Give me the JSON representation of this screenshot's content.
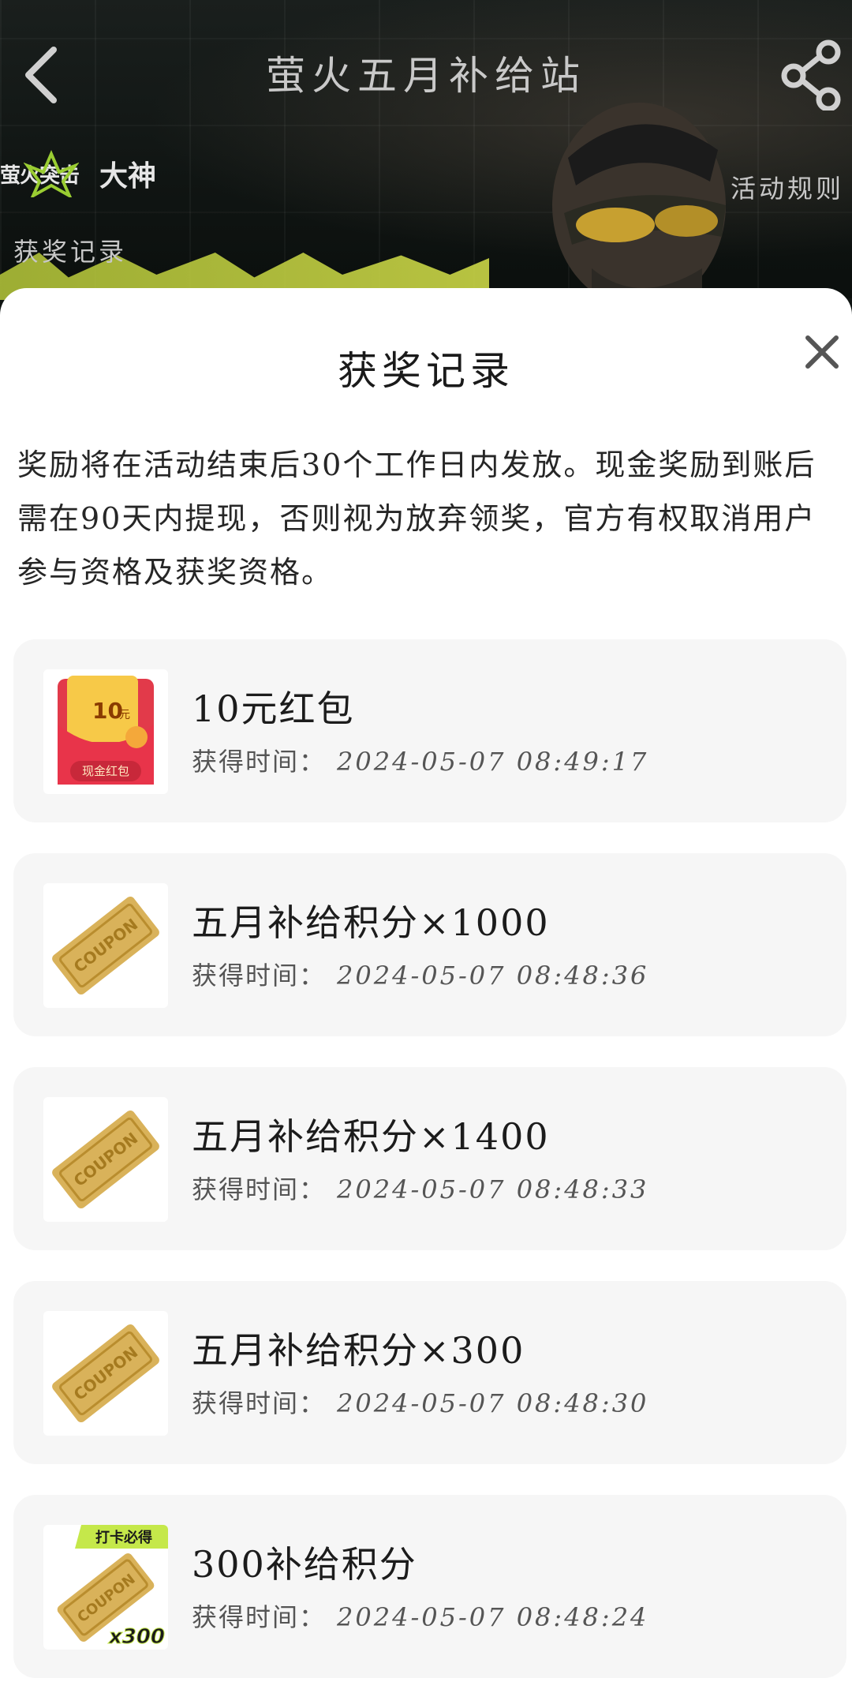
{
  "header": {
    "title": "萤火五月补给站",
    "brand_game": "萤火突击",
    "brand_partner": "大神",
    "link_rules": "活动规则",
    "link_records": "获奖记录"
  },
  "sheet": {
    "title": "获奖记录",
    "notice": "奖励将在活动结束后30个工作日内发放。现金奖励到账后需在90天内提现，否则视为放弃领奖，官方有权取消用户参与资格及获奖资格。",
    "time_label": "获得时间：",
    "records": [
      {
        "name": "10元红包",
        "time": "2024-05-07 08:49:17",
        "icon": "red-envelope-icon",
        "envelope_amount": "10",
        "envelope_unit": "元",
        "envelope_caption": "现金红包"
      },
      {
        "name": "五月补给积分×1000",
        "time": "2024-05-07 08:48:36",
        "icon": "coupon-ticket-icon",
        "ticket_text": "COUPON"
      },
      {
        "name": "五月补给积分×1400",
        "time": "2024-05-07 08:48:33",
        "icon": "coupon-ticket-icon",
        "ticket_text": "COUPON"
      },
      {
        "name": "五月补给积分×300",
        "time": "2024-05-07 08:48:30",
        "icon": "coupon-ticket-icon",
        "ticket_text": "COUPON"
      },
      {
        "name": "300补给积分",
        "time": "2024-05-07 08:48:24",
        "icon": "coupon-ticket-icon",
        "ticket_text": "COUPON",
        "badge": "打卡必得",
        "multiplier": "x300"
      }
    ]
  },
  "colors": {
    "sheet_bg": "#ffffff",
    "card_bg": "#f6f6f6",
    "accent_green": "#c5e84a",
    "ticket_gold": "#d9b25a",
    "envelope_red": "#e23a4a"
  }
}
